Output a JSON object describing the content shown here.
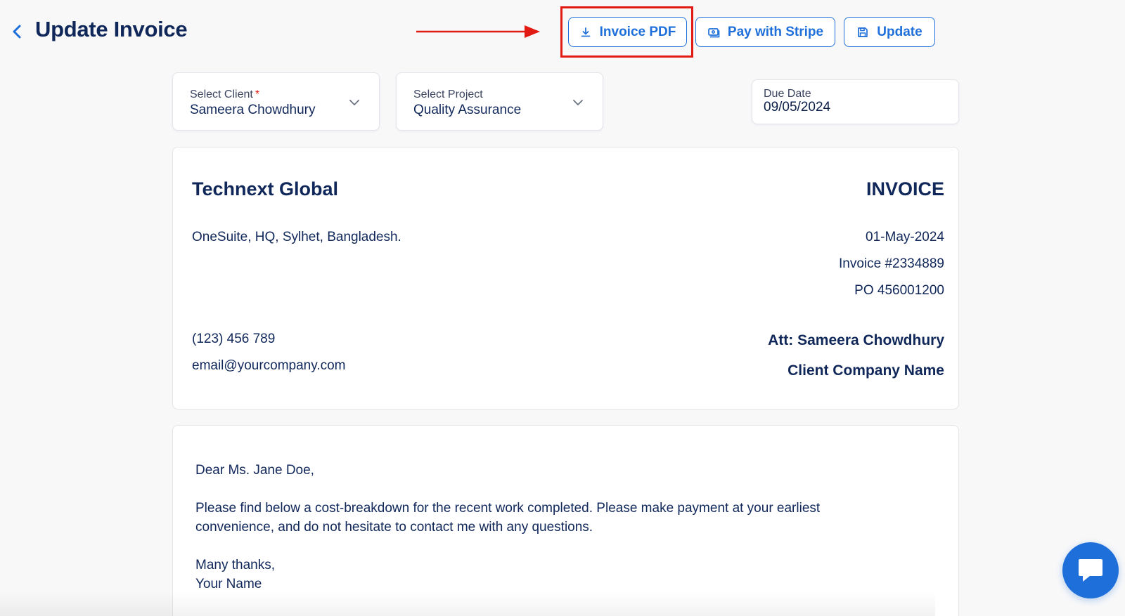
{
  "header": {
    "title": "Update Invoice",
    "back_icon": "chevron-left-icon"
  },
  "toolbar": {
    "invoice_pdf_label": "Invoice PDF",
    "invoice_pdf_icon": "download-icon",
    "pay_stripe_label": "Pay with Stripe",
    "pay_stripe_icon": "credit-card-icon",
    "update_label": "Update",
    "update_icon": "save-icon"
  },
  "annotation": {
    "arrow_color": "#e11b13",
    "highlight_color": "#e11b13"
  },
  "form": {
    "client": {
      "label": "Select Client",
      "required_mark": "*",
      "value": "Sameera Chowdhury"
    },
    "project": {
      "label": "Select Project",
      "value": "Quality Assurance"
    },
    "due_date": {
      "label": "Due Date",
      "value": "09/05/2024"
    }
  },
  "invoice": {
    "company_name": "Technext Global",
    "address": "OneSuite, HQ, Sylhet, Bangladesh.",
    "phone": "(123) 456 789",
    "email": "email@yourcompany.com",
    "title": "INVOICE",
    "date": "01-May-2024",
    "number": "Invoice #2334889",
    "po": "PO 456001200",
    "attention": "Att: Sameera Chowdhury",
    "client_company": "Client Company Name"
  },
  "letter": {
    "greeting": "Dear Ms. Jane Doe,",
    "body": "Please find below a cost-breakdown for the recent work completed. Please make payment at your earliest convenience, and do not hesitate to contact me with any questions.",
    "closing": "Many thanks,",
    "signature": "Your Name"
  },
  "chat": {
    "icon": "chat-bubble-icon"
  },
  "colors": {
    "accent": "#1e6fd9",
    "text_primary": "#10275a",
    "background": "#f8f8f9"
  }
}
